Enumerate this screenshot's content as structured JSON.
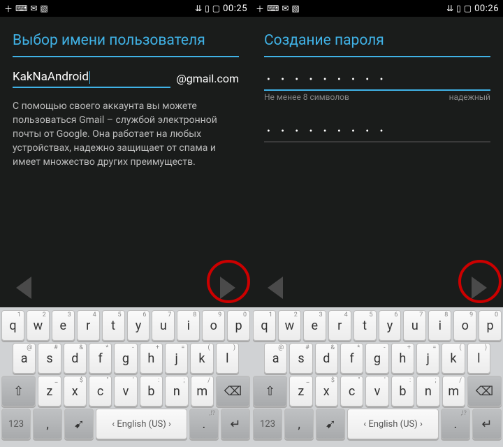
{
  "status": {
    "clock_left": "00:25",
    "clock_right": "00:26"
  },
  "left": {
    "title": "Выбор имени пользователя",
    "username": "KakNaAndroid",
    "domain": "@gmail.com",
    "description": "С помощью своего аккаунта вы можете пользоваться Gmail – службой электронной почты от Google. Она работает на любых устройствах, надежно защищает от спама и имеет множество других преимуществ."
  },
  "right": {
    "title": "Создание пароля",
    "pwd1": "• • • • • • • • •",
    "pwd2": "• • • • • • • • •",
    "hint_min": "Не менее 8 символов",
    "hint_strength": "надежный"
  },
  "kbd": {
    "row1": [
      {
        "k": "q",
        "s": "1"
      },
      {
        "k": "w",
        "s": "2"
      },
      {
        "k": "e",
        "s": "3"
      },
      {
        "k": "r",
        "s": "4"
      },
      {
        "k": "t",
        "s": "5"
      },
      {
        "k": "y",
        "s": "6"
      },
      {
        "k": "u",
        "s": "7"
      },
      {
        "k": "i",
        "s": "8"
      },
      {
        "k": "o",
        "s": "9"
      },
      {
        "k": "p",
        "s": "0"
      }
    ],
    "row2": [
      {
        "k": "a",
        "s": "@"
      },
      {
        "k": "s",
        "s": "#"
      },
      {
        "k": "d",
        "s": "&"
      },
      {
        "k": "f",
        "s": "*"
      },
      {
        "k": "g",
        "s": "-"
      },
      {
        "k": "h",
        "s": "+"
      },
      {
        "k": "j",
        "s": "="
      },
      {
        "k": "k",
        "s": "("
      },
      {
        "k": "l",
        "s": ")"
      }
    ],
    "row3": [
      {
        "k": "z",
        "s": "_"
      },
      {
        "k": "x",
        "s": "$"
      },
      {
        "k": "c",
        "s": "\""
      },
      {
        "k": "v",
        "s": "'"
      },
      {
        "k": "b",
        "s": ":"
      },
      {
        "k": "n",
        "s": ";"
      },
      {
        "k": "m",
        "s": "/"
      }
    ],
    "num_label": "123",
    "lang_label": "English (US)",
    "comma": ",",
    "period": ".",
    "exclaim": ",!?"
  }
}
